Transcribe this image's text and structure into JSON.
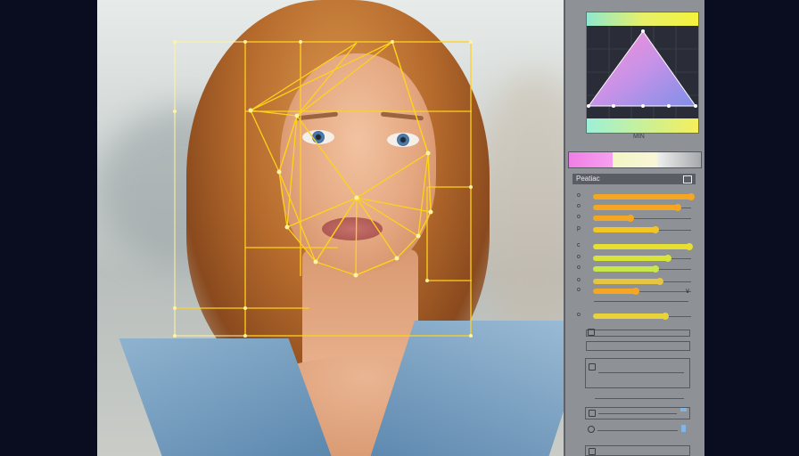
{
  "canvas": {
    "photo_subject": "",
    "landmark_points": 24
  },
  "panel": {
    "gamut_label": "MIN",
    "section_title": "Peatiac",
    "section_icon": "image-icon",
    "sliders_group1": [
      {
        "label": "o",
        "value": 1.0,
        "color": "#f5a623"
      },
      {
        "label": "o",
        "value": 0.86,
        "color": "#f5a623"
      },
      {
        "label": "o",
        "value": 0.38,
        "color": "#f5a623"
      },
      {
        "label": "p",
        "value": 0.64,
        "color": "#f5c623"
      }
    ],
    "sliders_group2": [
      {
        "label": "c",
        "value": 0.98,
        "color": "#e6e030"
      },
      {
        "label": "o",
        "value": 0.76,
        "color": "#d8e43a"
      },
      {
        "label": "o",
        "value": 0.64,
        "color": "#c8e84a"
      },
      {
        "label": "o",
        "value": 0.68,
        "color": "#e6c540"
      },
      {
        "label": "o",
        "value": 0.44,
        "color": "#f5a623"
      },
      {
        "label": "o",
        "value": 0.74,
        "color": "#e8d43a"
      }
    ],
    "colors": {
      "accent_yellow": "#ffe600",
      "overlay_line": "#ffd21a",
      "panel_bg": "#8e9196"
    }
  }
}
